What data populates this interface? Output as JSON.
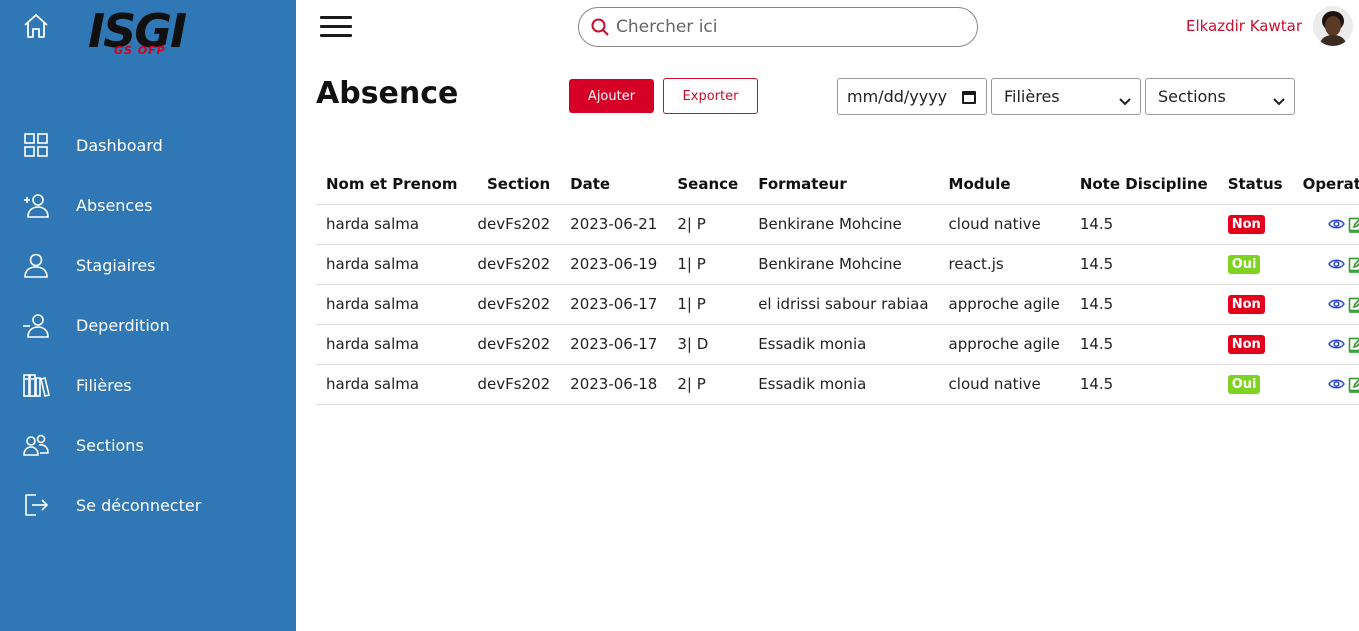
{
  "sidebar": {
    "logo_text": "ISGI",
    "logo_sub": "GS OFP",
    "items": [
      {
        "label": "Dashboard",
        "icon": "grid-icon"
      },
      {
        "label": "Absences",
        "icon": "user-plus-icon"
      },
      {
        "label": "Stagiaires",
        "icon": "user-icon"
      },
      {
        "label": "Deperdition",
        "icon": "user-minus-icon"
      },
      {
        "label": "Filières",
        "icon": "books-icon"
      },
      {
        "label": "Sections",
        "icon": "users-icon"
      },
      {
        "label": "Se déconnecter",
        "icon": "logout-icon"
      }
    ]
  },
  "header": {
    "search_placeholder": "Chercher ici",
    "user_name": "Elkazdir Kawtar"
  },
  "toolbar": {
    "title": "Absence",
    "add_label": "Ajouter",
    "export_label": "Exporter",
    "date_placeholder": "mm/dd/yyyy",
    "filieres_label": "Filières",
    "sections_label": "Sections"
  },
  "table": {
    "headers": [
      "Nom et Prenom",
      "Section",
      "Date",
      "Seance",
      "Formateur",
      "Module",
      "Note Discipline",
      "Status",
      "Operation"
    ],
    "rows": [
      {
        "name": "harda salma",
        "section": "devFs202",
        "date": "2023-06-21",
        "seance": "2| P",
        "formateur": "Benkirane Mohcine",
        "module": "cloud native",
        "note": "14.5",
        "status": "Non"
      },
      {
        "name": "harda salma",
        "section": "devFs202",
        "date": "2023-06-19",
        "seance": "1| P",
        "formateur": "Benkirane Mohcine",
        "module": "react.js",
        "note": "14.5",
        "status": "Oui"
      },
      {
        "name": "harda salma",
        "section": "devFs202",
        "date": "2023-06-17",
        "seance": "1| P",
        "formateur": "el idrissi sabour rabiaa",
        "module": "approche agile",
        "note": "14.5",
        "status": "Non"
      },
      {
        "name": "harda salma",
        "section": "devFs202",
        "date": "2023-06-17",
        "seance": "3| D",
        "formateur": "Essadik monia",
        "module": "approche agile",
        "note": "14.5",
        "status": "Non"
      },
      {
        "name": "harda salma",
        "section": "devFs202",
        "date": "2023-06-18",
        "seance": "2| P",
        "formateur": "Essadik monia",
        "module": "cloud native",
        "note": "14.5",
        "status": "Oui"
      }
    ]
  },
  "colors": {
    "sidebar": "#2f78b5",
    "accent": "#d60027",
    "status_non": "#e4001b",
    "status_oui": "#7ed321",
    "view_icon": "#2b4bd8",
    "edit_icon": "#2e9d2e",
    "delete_icon": "#e02020"
  }
}
